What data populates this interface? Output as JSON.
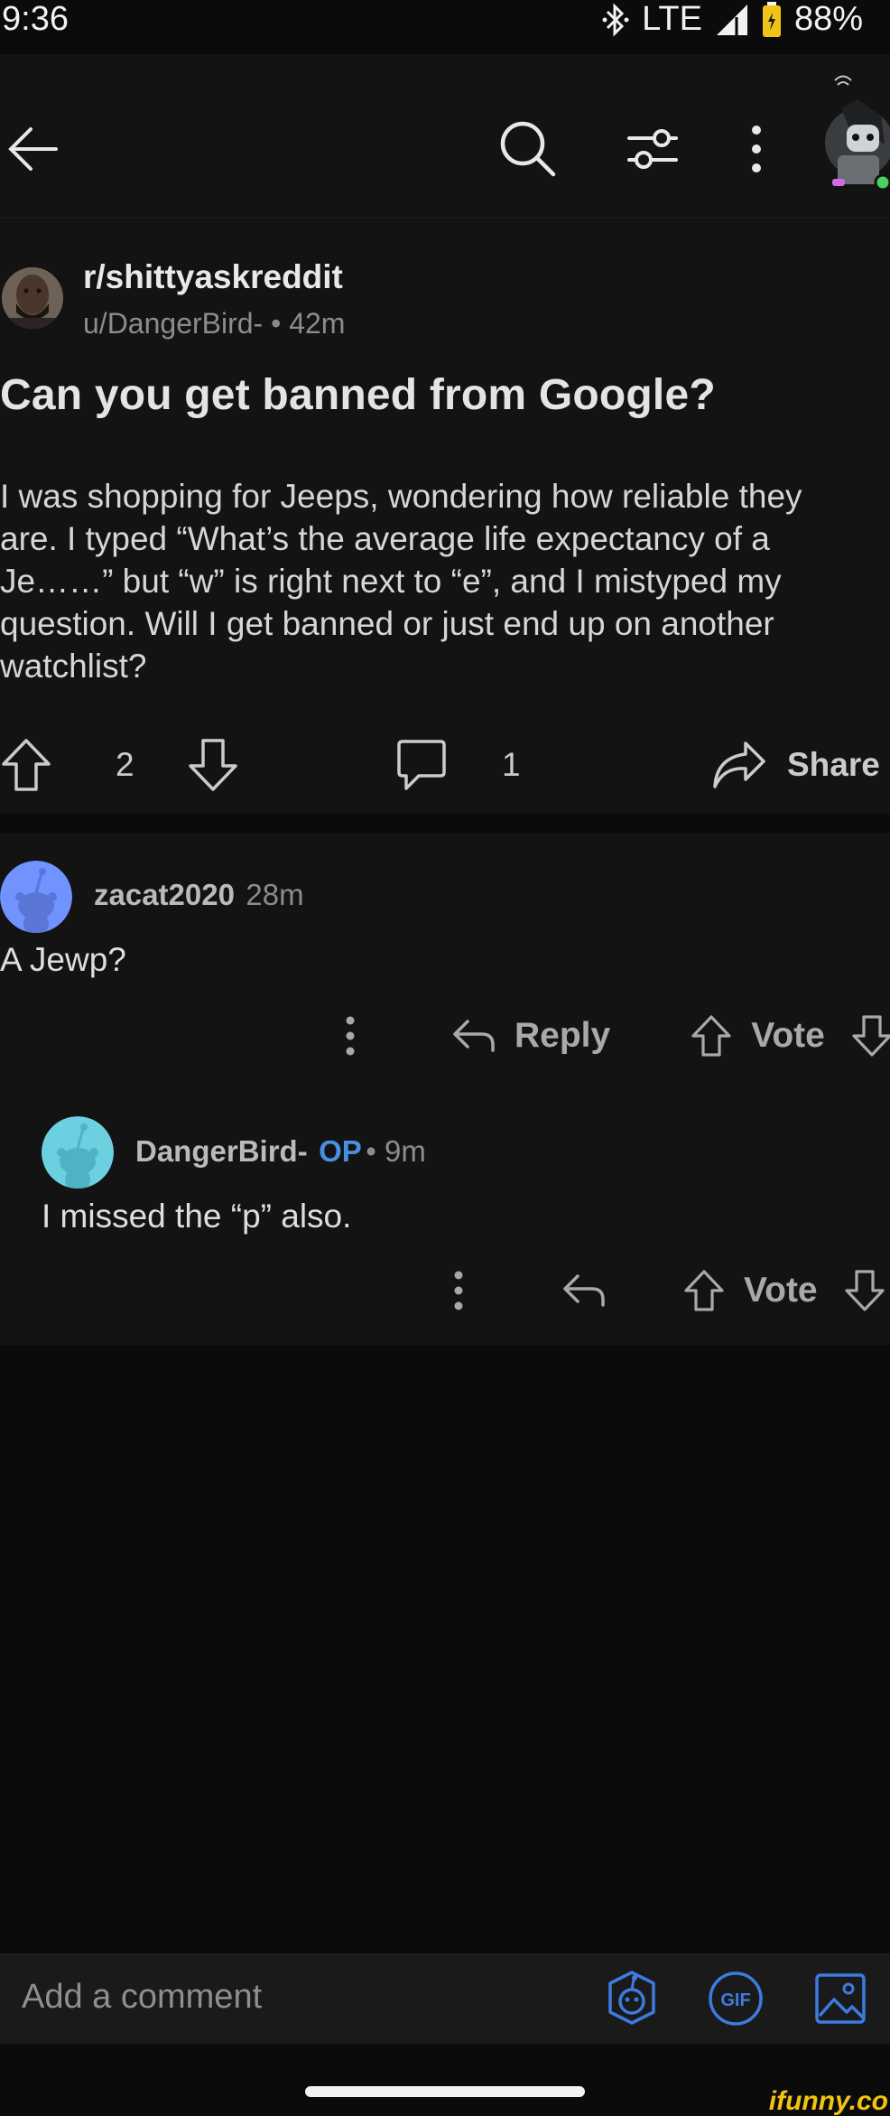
{
  "status_bar": {
    "time": "9:36",
    "network": "LTE",
    "battery": "88%"
  },
  "post": {
    "subreddit": "r/shittyaskreddit",
    "author": "u/DangerBird-",
    "age": "42m",
    "title": "Can you get banned from Google?",
    "body_lines": [
      "I was shopping for Jeeps, wondering how reliable they",
      "are. I typed “What’s the average life expectancy of a",
      "Je……” but “w” is right next to “e”, and I mistyped my",
      "question. Will I get banned or just end up on another",
      "watchlist?"
    ],
    "votes": "2",
    "comments": "1",
    "share_label": "Share"
  },
  "comments": [
    {
      "user": "zacat2020",
      "age": "28m",
      "text": "A Jewp?",
      "reply_label": "Reply",
      "vote_label": "Vote"
    },
    {
      "user": "DangerBird-",
      "op_badge": "OP",
      "age": "9m",
      "text": "I missed the “p” also.",
      "vote_label": "Vote"
    }
  ],
  "composer": {
    "placeholder": "Add a comment"
  },
  "watermark": "ifunny.co",
  "colors": {
    "background": "#0b0b0b",
    "card": "#131314",
    "op_blue": "#4a8fe0",
    "accent_blue": "#3d7be0"
  }
}
